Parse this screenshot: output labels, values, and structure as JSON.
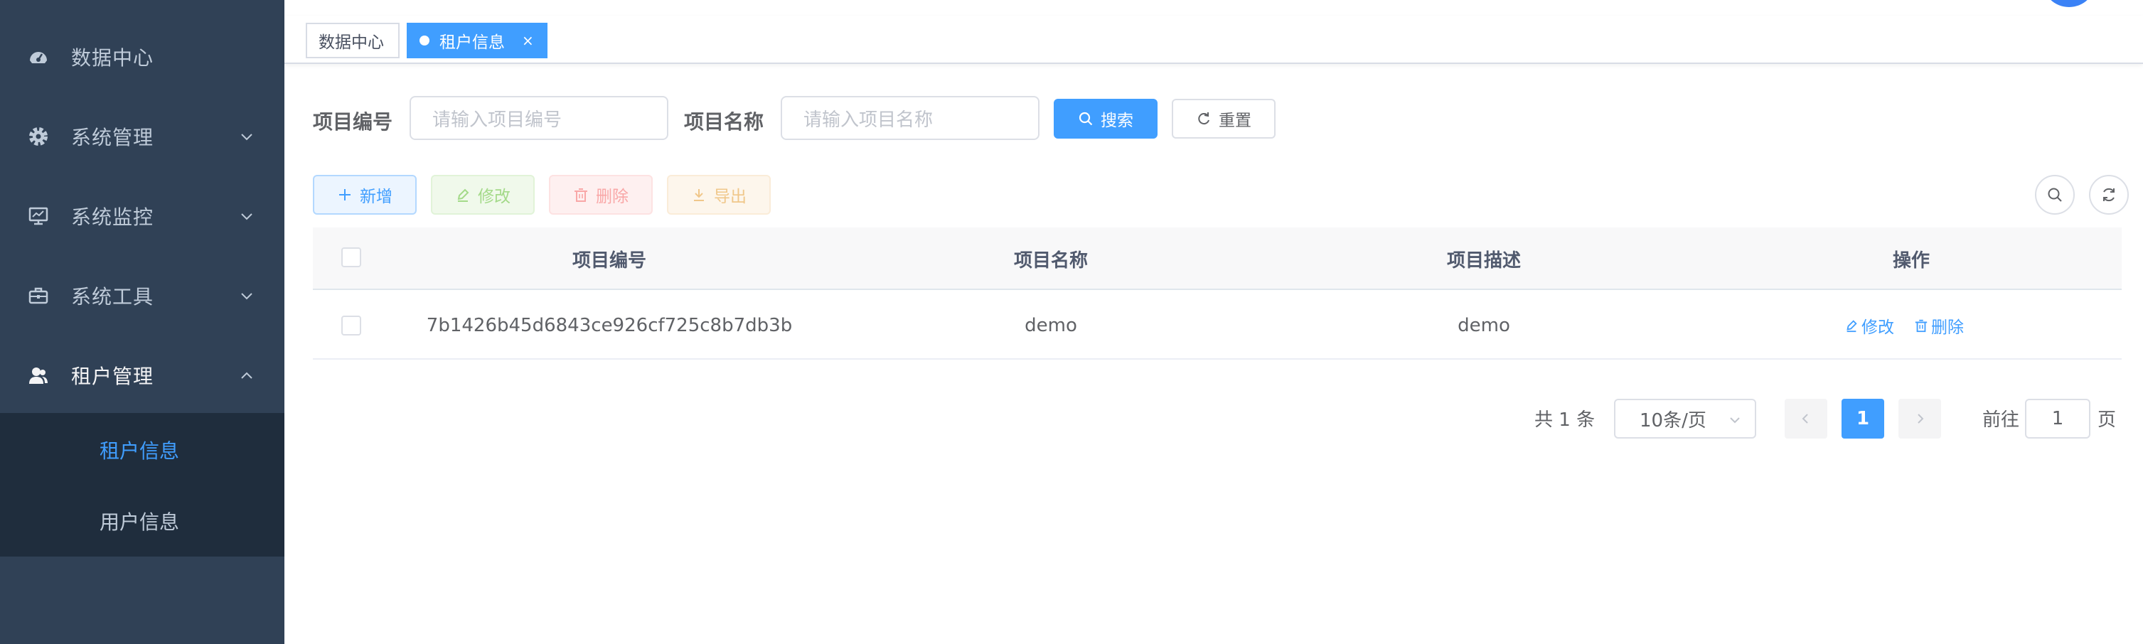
{
  "colors": {
    "sidebar_bg": "#304156",
    "submenu_bg": "#1f2d3d",
    "primary": "#409eff",
    "sidebar_text": "#bfcbd9"
  },
  "sidebar": {
    "items": [
      {
        "label": "数据中心",
        "icon": "dashboard-icon",
        "has_arrow": false
      },
      {
        "label": "系统管理",
        "icon": "gear-icon",
        "has_arrow": true,
        "expanded": false
      },
      {
        "label": "系统监控",
        "icon": "monitor-icon",
        "has_arrow": true,
        "expanded": false
      },
      {
        "label": "系统工具",
        "icon": "toolbox-icon",
        "has_arrow": true,
        "expanded": false
      },
      {
        "label": "租户管理",
        "icon": "users-icon",
        "has_arrow": true,
        "expanded": true
      }
    ],
    "submenu": [
      {
        "label": "租户信息",
        "active": true
      },
      {
        "label": "用户信息",
        "active": false
      }
    ]
  },
  "tags": [
    {
      "label": "数据中心",
      "active": false
    },
    {
      "label": "租户信息",
      "active": true,
      "close": "×"
    }
  ],
  "search": {
    "code_label": "项目编号",
    "code_placeholder": "请输入项目编号",
    "name_label": "项目名称",
    "name_placeholder": "请输入项目名称",
    "search_button": "搜索",
    "reset_button": "重置"
  },
  "toolbar": {
    "add": "新增",
    "edit": "修改",
    "delete": "删除",
    "export": "导出"
  },
  "table": {
    "columns": [
      "项目编号",
      "项目名称",
      "项目描述",
      "操作"
    ],
    "rows": [
      {
        "code": "7b1426b45d6843ce926cf725c8b7db3b",
        "name": "demo",
        "description": "demo",
        "actions": [
          "修改",
          "删除"
        ]
      }
    ]
  },
  "pagination": {
    "total": "共 1 条",
    "page_size": "10条/页",
    "current_page": "1",
    "goto_label": "前往",
    "goto_value": "1",
    "page_suffix": "页"
  }
}
